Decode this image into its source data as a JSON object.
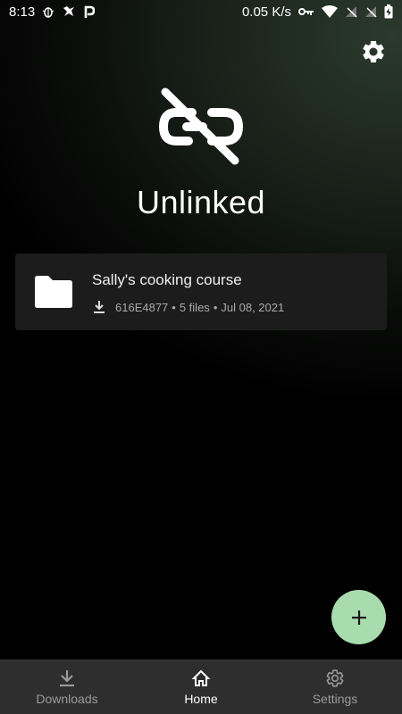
{
  "status_bar": {
    "time": "8:13",
    "net_speed": "0.05 K/s",
    "left_icons": [
      "bug-icon",
      "bird-icon",
      "p-icon"
    ],
    "right_icons": [
      "key-icon",
      "wifi-icon",
      "sim-no-signal-icon",
      "sim-no-signal-icon",
      "battery-charging-icon"
    ]
  },
  "header": {
    "settings_icon": "gear-icon"
  },
  "hero": {
    "icon": "link-off-icon",
    "title": "Unlinked"
  },
  "cards": [
    {
      "icon": "folder-icon",
      "title": "Sally's cooking course",
      "meta_icon": "download-icon",
      "code": "616E4877",
      "files": "5 files",
      "date": "Jul 08, 2021",
      "separator": "•"
    }
  ],
  "fab": {
    "icon": "plus-icon",
    "color": "#a8dcae"
  },
  "bottom_nav": {
    "items": [
      {
        "label": "Downloads",
        "icon": "download-icon",
        "active": false
      },
      {
        "label": "Home",
        "icon": "home-icon",
        "active": true
      },
      {
        "label": "Settings",
        "icon": "gear-icon",
        "active": false
      }
    ],
    "background": "#2e2e2e"
  }
}
